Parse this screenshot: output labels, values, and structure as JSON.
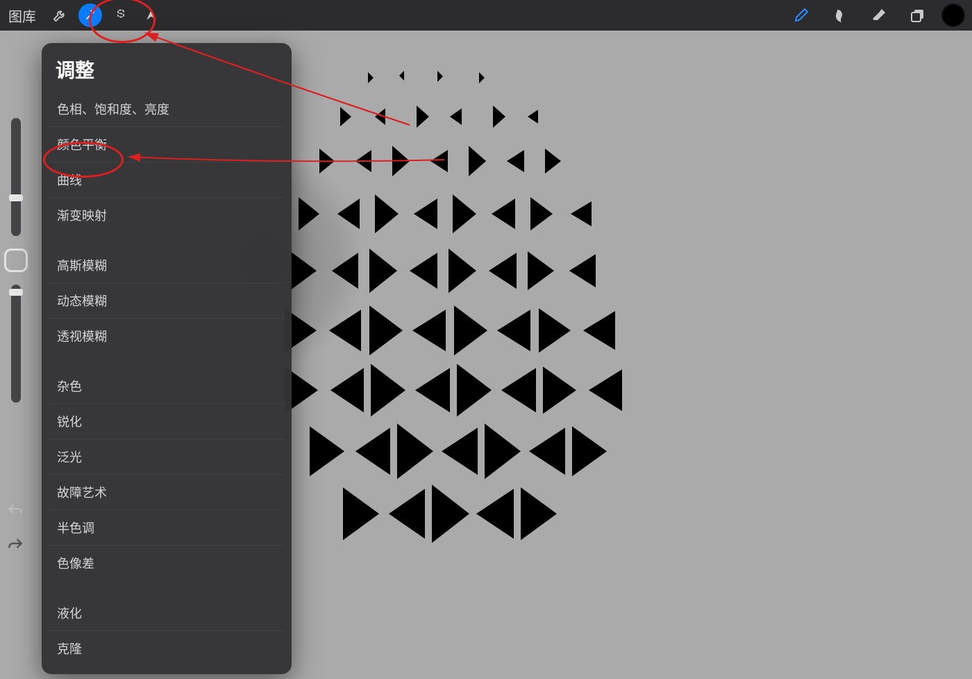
{
  "toolbar": {
    "gallery_label": "图库",
    "color_swatch": "#000000",
    "accent": "#0a7cff"
  },
  "popover": {
    "title": "调整",
    "groups": [
      {
        "items": [
          "色相、饱和度、亮度",
          "颜色平衡",
          "曲线",
          "渐变映射"
        ]
      },
      {
        "items": [
          "高斯模糊",
          "动态模糊",
          "透视模糊"
        ]
      },
      {
        "items": [
          "杂色",
          "锐化",
          "泛光",
          "故障艺术",
          "半色调",
          "色像差"
        ]
      },
      {
        "items": [
          "液化",
          "克隆"
        ]
      }
    ]
  }
}
